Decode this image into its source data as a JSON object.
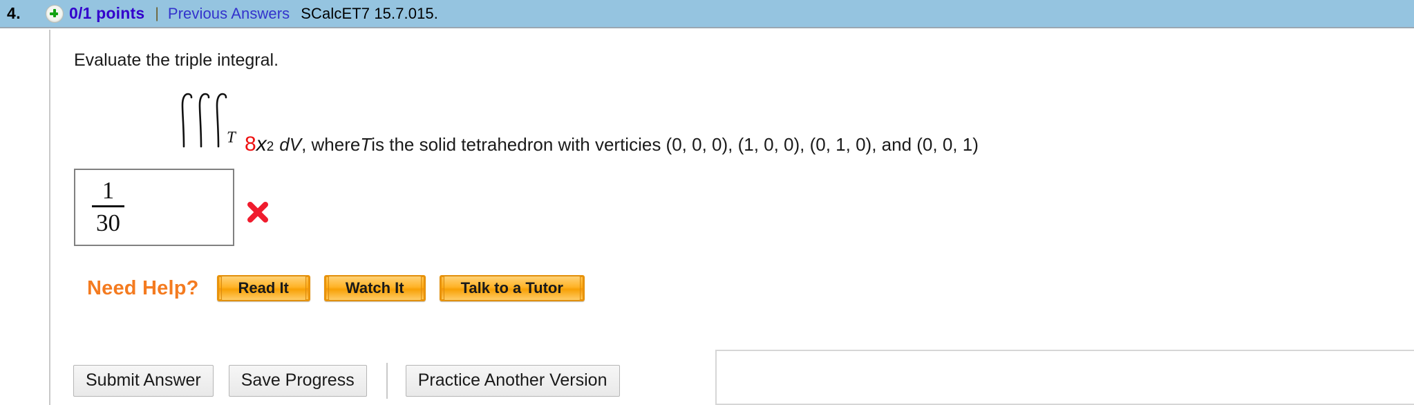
{
  "header": {
    "question_number": "4.",
    "status_icon": "plus-circle-icon",
    "points": "0/1 points",
    "divider": "|",
    "previous_answers_link": "Previous Answers",
    "source_code": "SCalcET7 15.7.015.",
    "background_color": "#95c4e0",
    "points_color": "#3300cc",
    "link_color": "#3333cc"
  },
  "question": {
    "prompt": "Evaluate the triple integral.",
    "integral_symbol": "triple-integral-icon",
    "integral_subscript": "T",
    "integrand_coefficient": "8",
    "integrand_variable": "x",
    "integrand_exponent": "2",
    "differential": "dV",
    "statement_part1": ", where ",
    "statement_region": "T",
    "statement_part2": " is the solid tetrahedron with verticies (0, 0, 0), (1, 0, 0), (0, 1, 0), and (0, 0, 1)",
    "coefficient_color": "#ee1111"
  },
  "answer": {
    "numerator": "1",
    "denominator": "30",
    "grade_icon": "incorrect-x-icon",
    "grade_color": "#f01c2e"
  },
  "need_help": {
    "label": "Need Help?",
    "label_color": "#f47b20",
    "buttons": [
      {
        "label": "Read It"
      },
      {
        "label": "Watch It"
      },
      {
        "label": "Talk to a Tutor"
      }
    ]
  },
  "actions": {
    "submit_label": "Submit Answer",
    "save_label": "Save Progress",
    "practice_label": "Practice Another Version"
  }
}
